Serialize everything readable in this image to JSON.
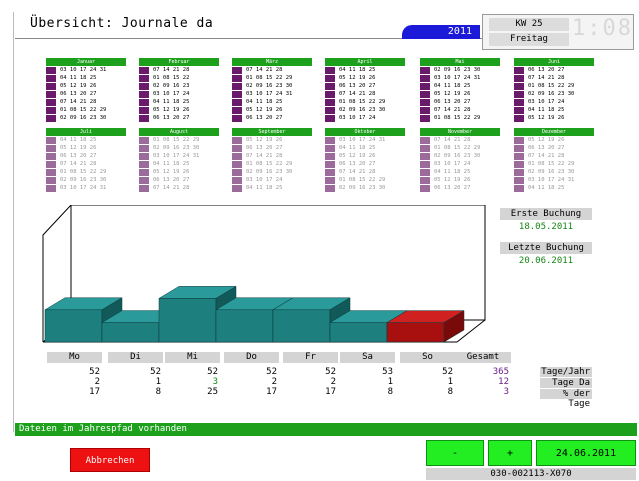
{
  "header": {
    "title": "Übersicht: Journale da",
    "year": "2011",
    "kw": "KW 25",
    "weekday": "Freitag",
    "clock": "1:08"
  },
  "months": [
    {
      "name": "Januar",
      "days": [
        "03 10 17 24 31",
        "04 11 18 25",
        "05 12 19 26",
        "06 13 20 27",
        "07 14 21 28",
        "01 08 15 22 29",
        "02 09 16 23 30"
      ]
    },
    {
      "name": "Februar",
      "days": [
        "07 14 21 28",
        "01 08 15 22",
        "02 09 16 23",
        "03 10 17 24",
        "04 11 18 25",
        "05 12 19 26",
        "06 13 20 27"
      ]
    },
    {
      "name": "März",
      "days": [
        "07 14 21 28",
        "01 08 15 22 29",
        "02 09 16 23 30",
        "03 10 17 24 31",
        "04 11 18 25",
        "05 12 19 26",
        "06 13 20 27"
      ]
    },
    {
      "name": "April",
      "days": [
        "04 11 18 25",
        "05 12 19 26",
        "06 13 20 27",
        "07 14 21 28",
        "01 08 15 22 29",
        "02 09 16 23 30",
        "03 10 17 24"
      ]
    },
    {
      "name": "Mai",
      "days": [
        "02 09 16 23 30",
        "03 10 17 24 31",
        "04 11 18 25",
        "05 12 19 26",
        "06 13 20 27",
        "07 14 21 28",
        "01 08 15 22 29"
      ]
    },
    {
      "name": "Juni",
      "days": [
        "06 13 20 27",
        "07 14 21 28",
        "01 08 15 22 29",
        "02 09 16 23 30",
        "03 10 17 24",
        "04 11 18 25",
        "05 12 19 26"
      ]
    },
    {
      "name": "Juli",
      "days": [
        "04 11 18 25",
        "05 12 19 26",
        "06 13 20 27",
        "07 14 21 28",
        "01 08 15 22 29",
        "02 09 16 23 30",
        "03 10 17 24 31"
      ]
    },
    {
      "name": "August",
      "days": [
        "01 08 15 22 29",
        "02 09 16 23 30",
        "03 10 17 24 31",
        "04 11 18 25",
        "05 12 19 26",
        "06 13 20 27",
        "07 14 21 28"
      ]
    },
    {
      "name": "September",
      "days": [
        "05 12 19 26",
        "06 13 20 27",
        "07 14 21 28",
        "01 08 15 22 29",
        "02 09 16 23 30",
        "03 10 17 24",
        "04 11 18 25"
      ]
    },
    {
      "name": "Oktober",
      "days": [
        "03 10 17 24 31",
        "04 11 18 25",
        "05 12 19 26",
        "06 13 20 27",
        "07 14 21 28",
        "01 08 15 22 29",
        "02 09 16 23 30"
      ]
    },
    {
      "name": "November",
      "days": [
        "07 14 21 28",
        "01 08 15 22 29",
        "02 09 16 23 30",
        "03 10 17 24",
        "04 11 18 25",
        "05 12 19 26",
        "06 13 20 27"
      ]
    },
    {
      "name": "Dezember",
      "days": [
        "05 12 19 26",
        "06 13 20 27",
        "07 14 21 28",
        "01 08 15 22 29",
        "02 09 16 23 30",
        "03 10 17 24 31",
        "04 11 18 25"
      ]
    }
  ],
  "info": {
    "first_label": "Erste  Buchung",
    "first_value": "18.05.2011",
    "last_label": "Letzte Buchung",
    "last_value": "20.06.2011"
  },
  "weekdays": [
    "Mo",
    "Di",
    "Mi",
    "Do",
    "Fr",
    "Sa",
    "So",
    "Gesamt"
  ],
  "stats": {
    "tage_jahr": [
      "52",
      "52",
      "52",
      "52",
      "52",
      "53",
      "52",
      "365"
    ],
    "tage_da": [
      "2",
      "1",
      "3",
      "2",
      "2",
      "1",
      "1",
      "12"
    ],
    "prozent": [
      "17",
      "8",
      "25",
      "17",
      "17",
      "8",
      "8",
      "3"
    ],
    "labels": [
      "Tage/Jahr",
      "Tage Da",
      "% der Tage"
    ]
  },
  "chart_data": {
    "type": "bar",
    "categories": [
      "Mo",
      "Di",
      "Mi",
      "Do",
      "Fr",
      "Sa",
      "So"
    ],
    "values": [
      17,
      8,
      25,
      17,
      17,
      8,
      8
    ],
    "colors": [
      "#1e7f7f",
      "#1e7f7f",
      "#1e7f7f",
      "#1e7f7f",
      "#1e7f7f",
      "#1e7f7f",
      "#a81010"
    ]
  },
  "status_text": "Dateien im Jahrespfad vorhanden",
  "buttons": {
    "cancel": "Abbrechen",
    "minus": "-",
    "plus": "+",
    "date": "24.06.2011"
  },
  "footer_code": "030-002113-X070"
}
